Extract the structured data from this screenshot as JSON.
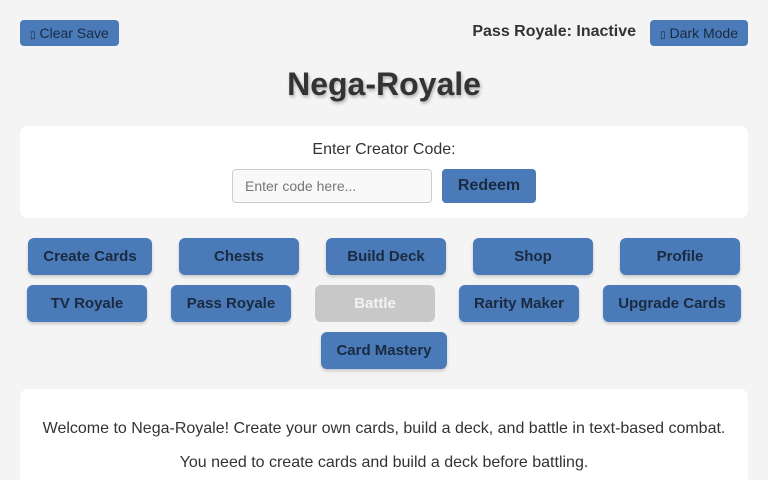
{
  "header": {
    "clear_save_label": "Clear Save",
    "clear_save_icon": "trash-icon",
    "pass_status": "Pass Royale: Inactive",
    "dark_mode_label": "Dark Mode",
    "dark_mode_icon": "moon-icon"
  },
  "title": "Nega-Royale",
  "creator_code": {
    "label": "Enter Creator Code:",
    "placeholder": "Enter code here...",
    "value": "",
    "redeem_label": "Redeem"
  },
  "nav": {
    "create_cards": "Create Cards",
    "chests": "Chests",
    "build_deck": "Build Deck",
    "shop": "Shop",
    "profile": "Profile",
    "tv_royale": "TV Royale",
    "pass_royale": "Pass Royale",
    "battle": "Battle",
    "rarity_maker": "Rarity Maker",
    "upgrade_cards": "Upgrade Cards",
    "card_mastery": "Card Mastery"
  },
  "info": {
    "welcome": "Welcome to Nega-Royale! Create your own cards, build a deck, and battle in text-based combat.",
    "hint": "You need to create cards and build a deck before battling."
  },
  "colors": {
    "button": "#4a7ab8",
    "button_text": "#1a2a40",
    "disabled": "#c8c8c8",
    "background": "#f4f4f4"
  }
}
